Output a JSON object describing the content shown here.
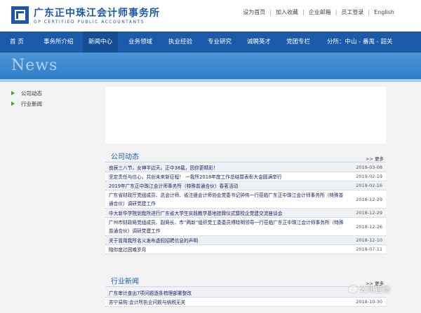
{
  "header": {
    "brand_cn": "广东正中珠江会计师事务所",
    "brand_en": "GP CERTIFIED PUBLIC ACCOUNTANTS",
    "links": [
      "设为首页",
      "加入收藏",
      "企业邮箱",
      "员工登录",
      "English"
    ]
  },
  "nav": {
    "items": [
      "首 页",
      "事务所介绍",
      "新闻中心",
      "业务领域",
      "执业经验",
      "专业研究",
      "诚聘英才",
      "党团专栏"
    ],
    "branch": "分所：中山 - 番禺 - 韶关",
    "active_index": 2
  },
  "banner": {
    "title": "News"
  },
  "sidebar": {
    "items": [
      "公司动态",
      "行业新闻"
    ]
  },
  "company_news": {
    "title": "公司动态",
    "more": ">> 更多",
    "rows": [
      {
        "text": "良辰三八节，女神半边天。正中38载，因你更精彩！",
        "date": "2019-03-08"
      },
      {
        "text": "坚定责任与信心，共创未来新征程！ —我所2018年度工作总结暨表彰大会圆满举行",
        "date": "2019-02-19"
      },
      {
        "text": "2019年广东正中珠江会计师事务所（特殊普通合伙）春茗活动",
        "date": "2019-02-16"
      },
      {
        "text": "广东省财政厅党组成员、总会计师、省注册会计师协会党委书记钟伟一行莅临广东正中珠江会计师事务所（特殊普通合伙）调研党建工作",
        "date": "2018-12-29"
      },
      {
        "text": "中大新华学院到我所进行广东省大学生实践教学基地挂牌仪式暨校企党建交流座谈会",
        "date": "2018-12-29"
      },
      {
        "text": "广州市财政局党组成员、副局长、市“两新”组织党工委委员傅晓明领导一行莅临广东正中珠江会计师事务所（特殊普通合伙）调研党建工作",
        "date": "2018-12-26"
      },
      {
        "text": "关于冒用我所名义发布虚假招聘信息的声明",
        "date": "2018-12-10"
      },
      {
        "text": "陪你度过困难岁月",
        "date": "2018-07-11"
      }
    ]
  },
  "industry_news": {
    "title": "行业新闻",
    "more": ">> 更多",
    "rows": [
      {
        "text": "广东审计查出7项问题逐条梳理部署整改",
        "date": ""
      },
      {
        "text": "苏宁易购:会计所执业问题与纳税无关",
        "date": "2018-10-30"
      }
    ]
  },
  "watermark": {
    "text": "公司官微"
  }
}
